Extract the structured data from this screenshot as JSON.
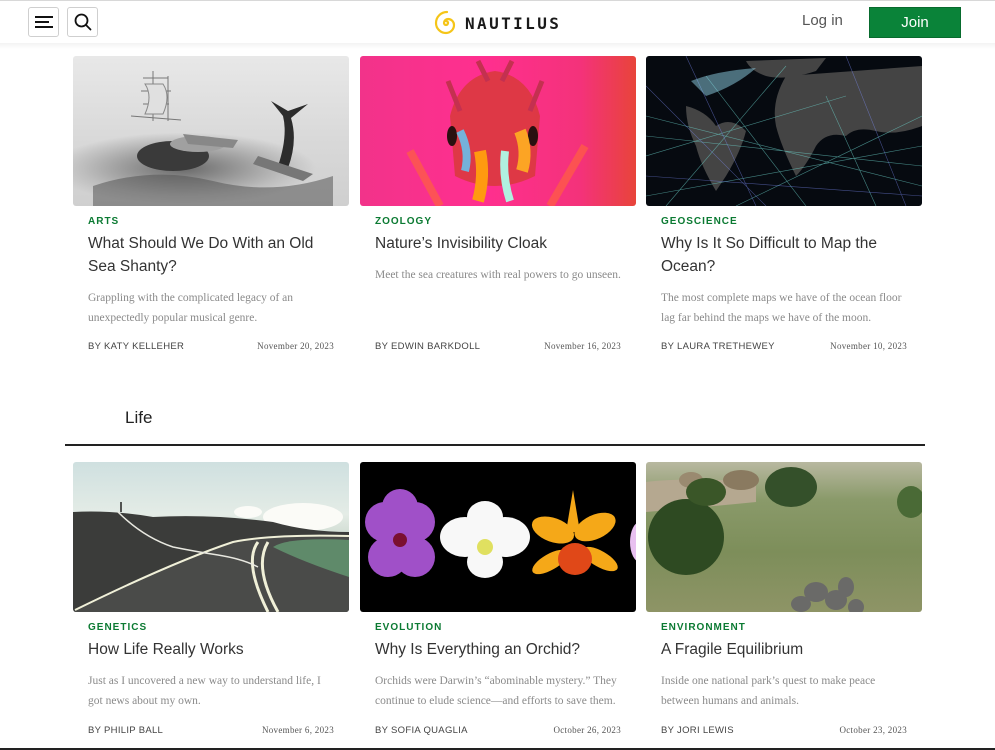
{
  "header": {
    "menu_icon": "hamburger-menu-icon",
    "search_icon": "search-icon",
    "logo_icon": "nautilus-spiral-icon",
    "logo_text": "NAUTILUS",
    "login_label": "Log in",
    "join_label": "Join",
    "brand_color": "#0a8339",
    "logo_color": "#f5c518"
  },
  "top_row": [
    {
      "category": "ARTS",
      "title": "What Should We Do With an Old Sea Shanty?",
      "dek": "Grappling with the complicated legacy of an unexpectedly popular musical genre.",
      "byline": "BY KATY KELLEHER",
      "date": "November 20, 2023",
      "image": "whaling-engraving-image"
    },
    {
      "category": "ZOOLOGY",
      "title": "Nature’s Invisibility Cloak",
      "dek": "Meet the sea creatures with real powers to go unseen.",
      "byline": "BY EDWIN BARKDOLL",
      "date": "November 16, 2023",
      "image": "translucent-crustacean-image"
    },
    {
      "category": "GEOSCIENCE",
      "title": "Why Is It So Difficult to Map the Ocean?",
      "dek": "The most complete maps we have of the ocean floor lag far behind the maps we have of the moon.",
      "byline": "BY LAURA TRETHEWEY",
      "date": "November 10, 2023",
      "image": "ocean-floor-map-image"
    }
  ],
  "section": {
    "title": "Life"
  },
  "bottom_row": [
    {
      "category": "GENETICS",
      "title": "How Life Really Works",
      "dek": "Just as I uncovered a new way to understand life, I got news about my own.",
      "byline": "BY PHILIP BALL",
      "date": "November 6, 2023",
      "image": "winding-road-image"
    },
    {
      "category": "EVOLUTION",
      "title": "Why Is Everything an Orchid?",
      "dek": "Orchids were Darwin’s “abominable mystery.” They continue to elude science—and efforts to save them.",
      "byline": "BY SOFIA QUAGLIA",
      "date": "October 26, 2023",
      "image": "orchids-image"
    },
    {
      "category": "ENVIRONMENT",
      "title": "A Fragile Equilibrium",
      "dek": "Inside one national park’s quest to make peace between humans and animals.",
      "byline": "BY JORI LEWIS",
      "date": "October 23, 2023",
      "image": "elephants-field-image"
    }
  ]
}
